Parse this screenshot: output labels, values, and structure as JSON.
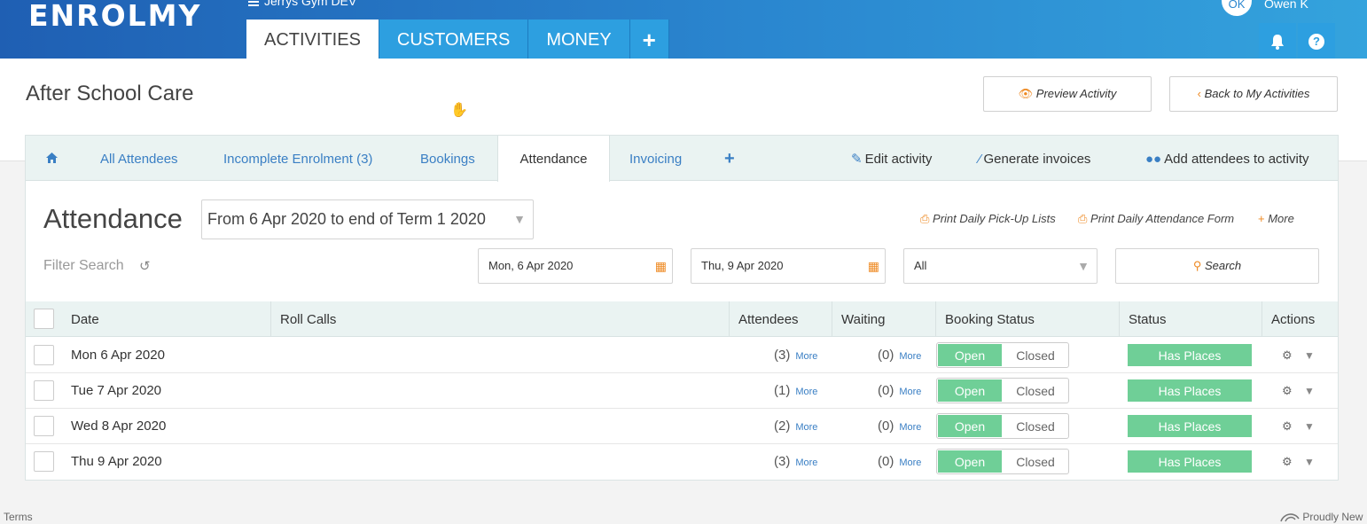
{
  "header": {
    "logo": "ENROLMY",
    "org_name": "Jerrys Gym DEV",
    "tabs": [
      {
        "label": "ACTIVITIES",
        "active": true
      },
      {
        "label": "CUSTOMERS",
        "active": false
      },
      {
        "label": "MONEY",
        "active": false
      },
      {
        "label": "+",
        "active": false
      }
    ],
    "user_initials": "OK",
    "user_name": "Owen K",
    "icons": [
      "bell-icon",
      "help-icon"
    ]
  },
  "page": {
    "title": "After School Care",
    "preview_label": "Preview Activity",
    "back_label": "Back to My Activities"
  },
  "subnav": {
    "tabs": [
      {
        "label": "",
        "icon": "home-icon"
      },
      {
        "label": "All Attendees"
      },
      {
        "label": "Incomplete Enrolment (3)"
      },
      {
        "label": "Bookings"
      },
      {
        "label": "Attendance",
        "active": true
      },
      {
        "label": "Invoicing"
      },
      {
        "label": "+",
        "icon": "plus-icon"
      }
    ],
    "actions": [
      {
        "label": "Edit activity",
        "icon": "pencil-icon"
      },
      {
        "label": "Generate invoices",
        "icon": "magic-wand-icon"
      },
      {
        "label": "Add attendees to activity",
        "icon": "users-icon"
      }
    ]
  },
  "attendance": {
    "title": "Attendance",
    "range_value": "From 6 Apr 2020 to end of Term 1 2020",
    "print_pickup": "Print Daily Pick-Up Lists",
    "print_form": "Print Daily Attendance Form",
    "more_label": "More",
    "filter_label": "Filter Search",
    "start_date": "Mon, 6 Apr 2020",
    "end_date": "Thu, 9 Apr 2020",
    "status_filter": "All",
    "search_label": "Search"
  },
  "table": {
    "columns": [
      "Date",
      "Roll Calls",
      "Attendees",
      "Waiting",
      "Booking Status",
      "Status",
      "Actions"
    ],
    "rows": [
      {
        "date": "Mon 6 Apr 2020",
        "attendees": "(3)",
        "waiting": "(0)",
        "more": "More",
        "open": "Open",
        "closed": "Closed",
        "status": "Has Places"
      },
      {
        "date": "Tue 7 Apr 2020",
        "attendees": "(1)",
        "waiting": "(0)",
        "more": "More",
        "open": "Open",
        "closed": "Closed",
        "status": "Has Places"
      },
      {
        "date": "Wed 8 Apr 2020",
        "attendees": "(2)",
        "waiting": "(0)",
        "more": "More",
        "open": "Open",
        "closed": "Closed",
        "status": "Has Places"
      },
      {
        "date": "Thu 9 Apr 2020",
        "attendees": "(3)",
        "waiting": "(0)",
        "more": "More",
        "open": "Open",
        "closed": "Closed",
        "status": "Has Places"
      }
    ]
  },
  "footer": {
    "terms": "Terms",
    "proudly": "Proudly New"
  },
  "colors": {
    "header_blue": "#2a86cf",
    "link_blue": "#3a7fc4",
    "accent_orange": "#ee8a23",
    "status_green": "#6fcf97"
  }
}
